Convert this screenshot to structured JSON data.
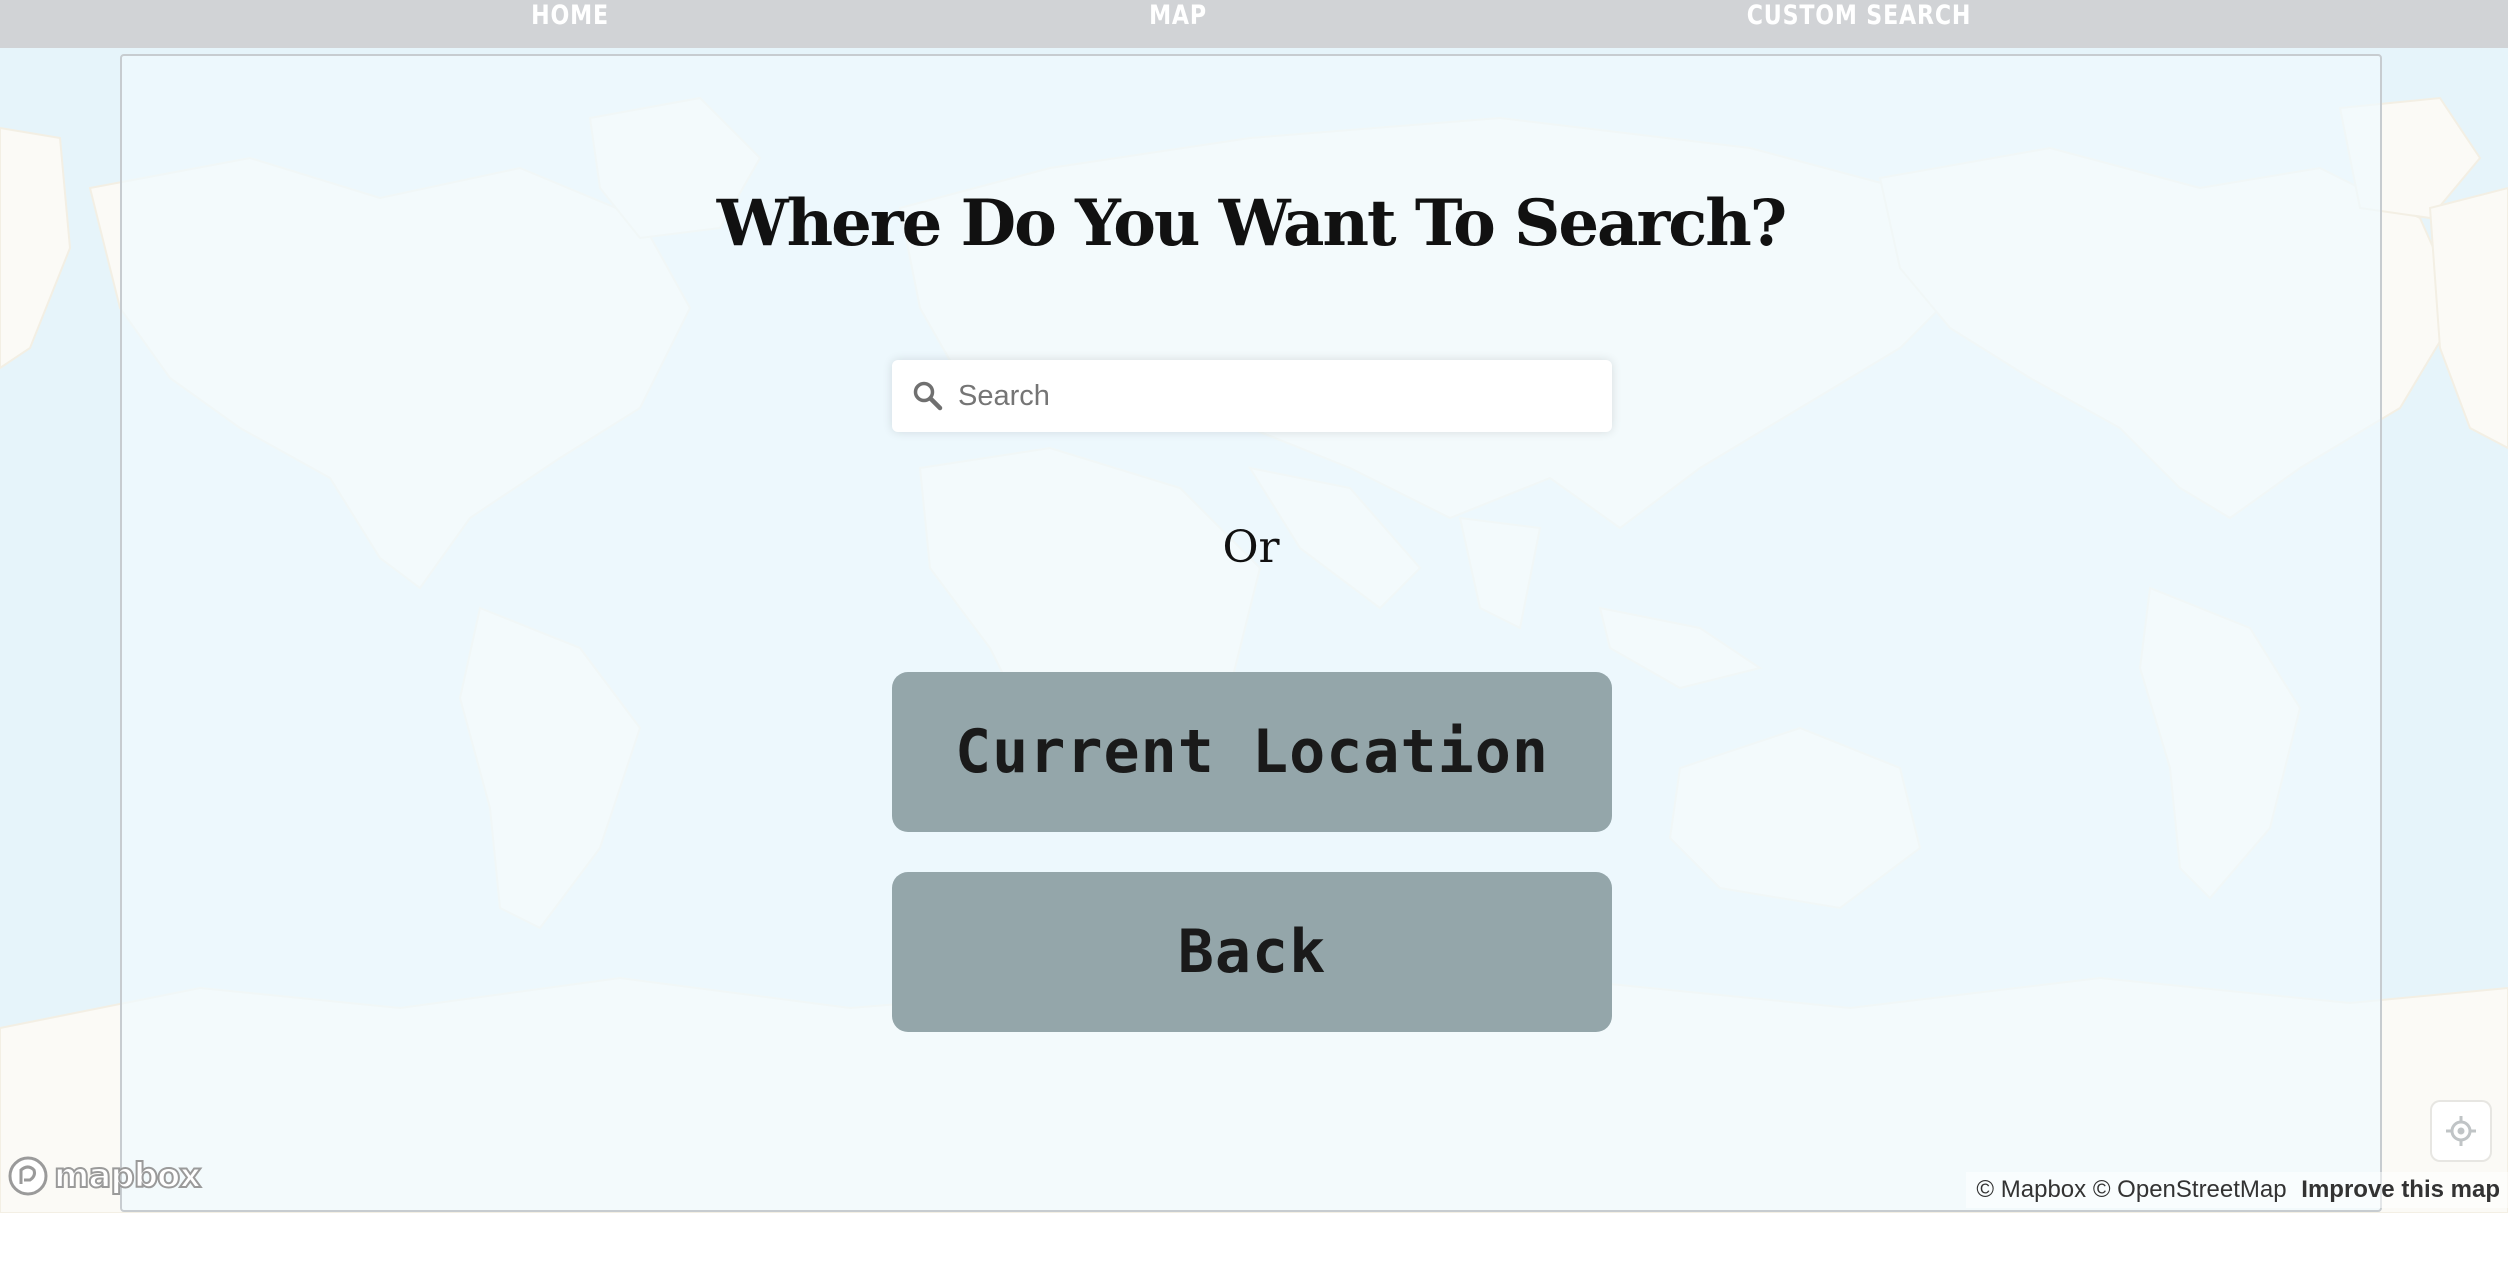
{
  "nav": {
    "items": [
      {
        "label": "HOME"
      },
      {
        "label": "MAP"
      },
      {
        "label": "CUSTOM SEARCH"
      }
    ]
  },
  "main": {
    "title": "Where Do You Want To Search?",
    "search": {
      "placeholder": "Search",
      "value": ""
    },
    "or_label": "Or",
    "current_location_label": "Current Location",
    "back_label": "Back"
  },
  "map": {
    "logo_text": "mapbox",
    "attribution": {
      "mapbox": "© Mapbox",
      "osm": "© OpenStreetMap",
      "improve": "Improve this map"
    },
    "icons": {
      "geolocate": "geolocate-icon",
      "search": "search-icon"
    }
  },
  "colors": {
    "nav_bg": "#d1d3d6",
    "water": "#e6f4fa",
    "land": "#fbfaf6",
    "button_bg": "#94a6aa",
    "button_text": "#1a1a1a"
  }
}
